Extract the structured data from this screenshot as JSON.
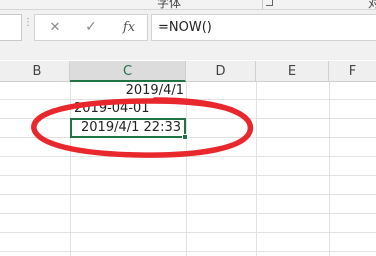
{
  "ribbon": {
    "group_font_label": "字体",
    "group_align_label": "对"
  },
  "formula_bar": {
    "cancel_glyph": "✕",
    "enter_glyph": "✓",
    "fx_label": "fx",
    "formula": "=NOW()"
  },
  "columns": [
    "B",
    "C",
    "D",
    "E",
    "F"
  ],
  "active_column": "C",
  "cells": {
    "c1": "2019/4/1",
    "c2": "2019-04-01",
    "c3": "2019/4/1 22:33"
  },
  "colors": {
    "accent": "#217346",
    "annotation": "#e8282d"
  }
}
